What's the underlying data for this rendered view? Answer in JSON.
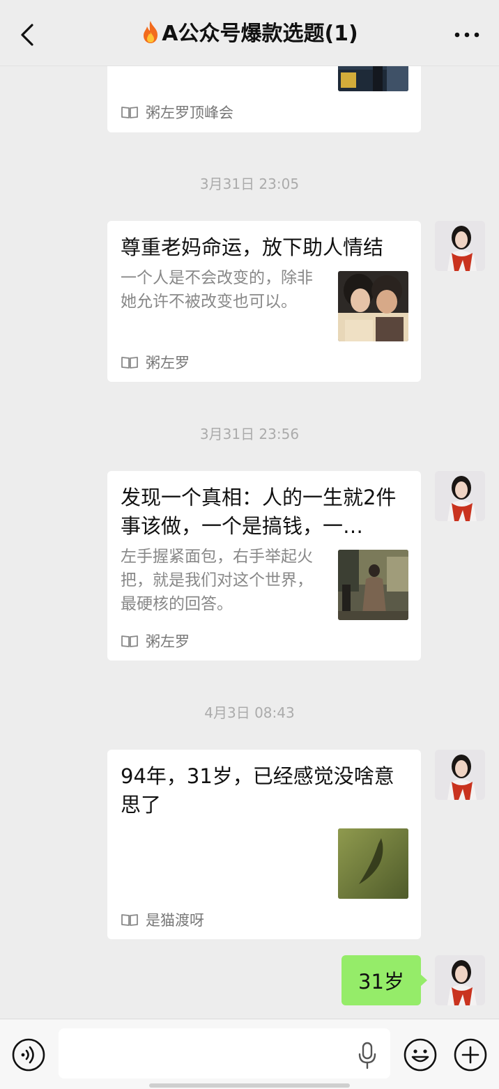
{
  "header": {
    "title": "A公众号爆款选题(1)",
    "title_icon": "fire-emoji",
    "back_icon": "chevron-left-icon",
    "more_icon": "ellipsis-icon"
  },
  "messages": [
    {
      "source": "粥左罗顶峰会"
    },
    {
      "timestamp": "3月31日 23:05",
      "title": "尊重老妈命运，放下助人情结",
      "desc": "一个人是不会改变的，除非她允许不被改变也可以。",
      "source": "粥左罗"
    },
    {
      "timestamp": "3月31日 23:56",
      "title": "发现一个真相：人的一生就2件事该做，一个是搞钱，一…",
      "desc": "左手握紧面包，右手举起火把，就是我们对这个世界，最硬核的回答。",
      "source": "粥左罗"
    },
    {
      "timestamp": "4月3日 08:43",
      "title": "94年，31岁，已经感觉没啥意思了",
      "desc": "",
      "source": "是猫渡呀"
    }
  ],
  "reply": {
    "text": "31岁"
  },
  "input_bar": {
    "value": "",
    "placeholder": ""
  },
  "colors": {
    "background": "#ededed",
    "bubble": "#95ec69",
    "card": "#ffffff",
    "timestamp": "#ababab"
  }
}
